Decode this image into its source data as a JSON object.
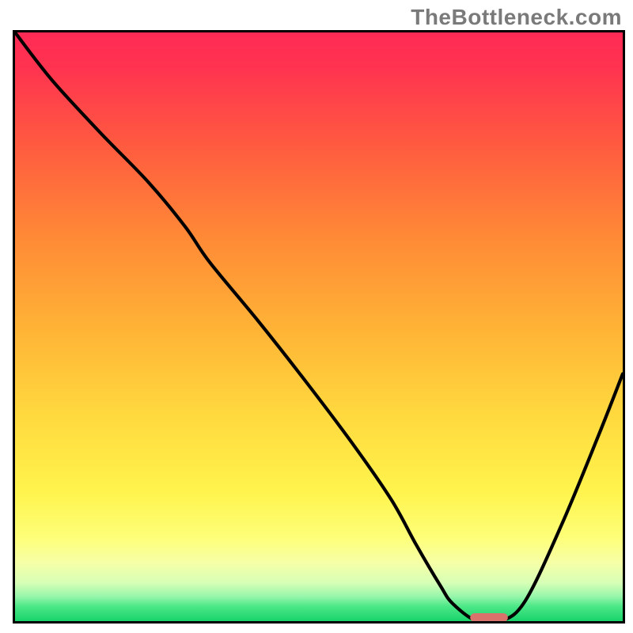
{
  "watermark": "TheBottleneck.com",
  "chart_data": {
    "type": "line",
    "title": "",
    "xlabel": "",
    "ylabel": "",
    "xlim": [
      0,
      100
    ],
    "ylim": [
      0,
      100
    ],
    "background_gradient": {
      "stops": [
        {
          "offset": 0.0,
          "color": "#ff2a55"
        },
        {
          "offset": 0.06,
          "color": "#ff3350"
        },
        {
          "offset": 0.2,
          "color": "#ff5d3f"
        },
        {
          "offset": 0.35,
          "color": "#ff8a36"
        },
        {
          "offset": 0.5,
          "color": "#ffb236"
        },
        {
          "offset": 0.65,
          "color": "#ffd93e"
        },
        {
          "offset": 0.78,
          "color": "#fff44d"
        },
        {
          "offset": 0.86,
          "color": "#feff7a"
        },
        {
          "offset": 0.9,
          "color": "#f6ffa6"
        },
        {
          "offset": 0.935,
          "color": "#d7ffb6"
        },
        {
          "offset": 0.958,
          "color": "#97f6ab"
        },
        {
          "offset": 0.975,
          "color": "#4ce787"
        },
        {
          "offset": 1.0,
          "color": "#18d36a"
        }
      ]
    },
    "series": [
      {
        "name": "bottleneck-curve",
        "x": [
          0,
          6,
          14,
          22,
          28,
          32,
          40,
          48,
          56,
          62,
          66,
          70,
          72,
          76,
          80,
          84,
          90,
          96,
          100
        ],
        "y": [
          100,
          92,
          83,
          74.5,
          67,
          61,
          51,
          40.5,
          29.5,
          20.5,
          13,
          6,
          3,
          0,
          0,
          3.5,
          16.5,
          31.5,
          42
        ]
      }
    ],
    "marker": {
      "name": "optimal-marker",
      "x_center": 78.0,
      "y": 0.6,
      "width": 6.2,
      "height": 1.5,
      "rx": 0.8,
      "color": "#d9726a"
    }
  }
}
